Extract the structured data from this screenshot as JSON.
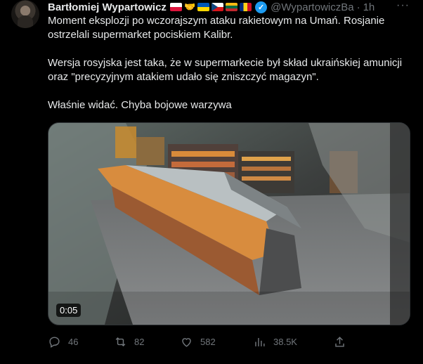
{
  "author": {
    "name": "Bartłomiej Wypartowicz",
    "handle": "@WypartowiczBa",
    "time": "1h",
    "hands_emoji": "🤝"
  },
  "tweet": {
    "paragraph1": "Moment eksplozji po wczorajszym ataku rakietowym na Umań. Rosjanie ostrzelali supermarket pociskiem Kalibr.",
    "paragraph2": "Wersja rosyjska jest taka, że w supermarkecie był skład ukraińskiej amunicji oraz \"precyzyjnym atakiem udało się zniszczyć magazyn\".",
    "paragraph3": "Właśnie widać. Chyba bojowe warzywa"
  },
  "media": {
    "duration": "0:05"
  },
  "actions": {
    "replies": "46",
    "retweets": "82",
    "likes": "582",
    "views": "38.5K"
  },
  "colors": {
    "background": "#000000",
    "text": "#e7e9ea",
    "secondary": "#71767b",
    "verified": "#1d9bf0"
  }
}
